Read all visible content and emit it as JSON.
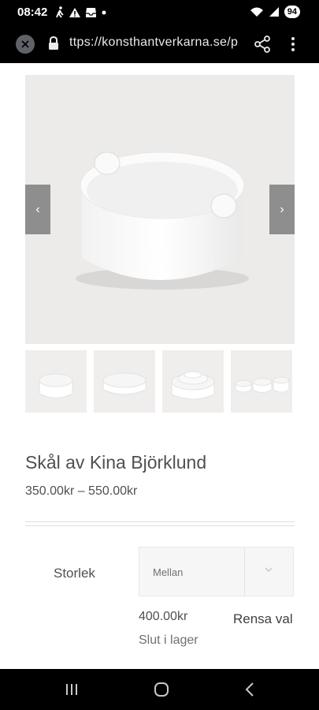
{
  "status_bar": {
    "time": "08:42",
    "battery": "94",
    "icons": [
      "walk-icon",
      "warning-icon",
      "inbox-icon",
      "dot-icon",
      "wifi-icon",
      "signal-icon"
    ]
  },
  "browser": {
    "url": "ttps://konsthantverkarna.se/p",
    "icons": [
      "close-icon",
      "lock-icon",
      "share-icon",
      "more-vert-icon"
    ]
  },
  "product": {
    "title": "Skål av Kina Björklund",
    "price_range": "350.00kr – 550.00kr",
    "gallery": {
      "prev_label": "‹",
      "next_label": "›",
      "thumbnail_count": 4
    }
  },
  "variation": {
    "label": "Storlek",
    "selected": "Mellan",
    "price": "400.00kr",
    "stock": "Slut i lager",
    "clear": "Rensa val"
  },
  "android_nav": {
    "icons": [
      "recents-icon",
      "home-icon",
      "back-icon"
    ]
  }
}
